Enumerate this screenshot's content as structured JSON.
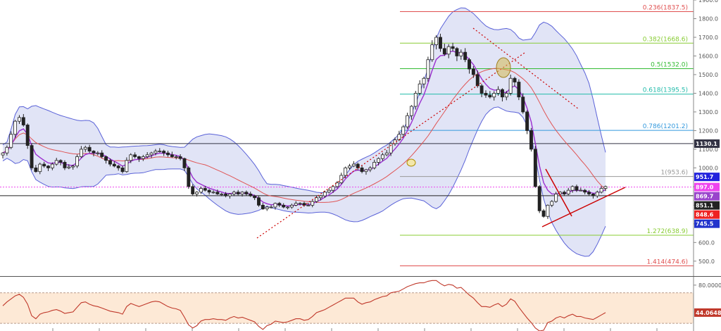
{
  "chart_data": [
    {
      "type": "candlestick",
      "panel": "price",
      "ylim": [
        420,
        1900
      ],
      "y_axis_side": "right",
      "y_ticks": [
        "500.0",
        "600.0",
        "700.0",
        "800.0",
        "900.0",
        "1000.0",
        "1100.0",
        "1200.0",
        "1300.0",
        "1400.0",
        "1500.0",
        "1600.0",
        "1700.0",
        "1800.0",
        "1900.0"
      ],
      "y_tick_values": [
        500,
        600,
        700,
        800,
        900,
        1000,
        1100,
        1200,
        1300,
        1400,
        1500,
        1600,
        1700,
        1800,
        1900
      ],
      "grid": false,
      "indicators": [
        "Bollinger Bands",
        "EMA (purple)",
        "SMA (red)"
      ],
      "fib_levels": [
        {
          "label": "0.236(1837.5)",
          "value": 1837.5,
          "color": "#e05050"
        },
        {
          "label": "0.382(1668.6)",
          "value": 1668.6,
          "color": "#88cc33"
        },
        {
          "label": "0.5(1532.0)",
          "value": 1532.0,
          "color": "#33bb33"
        },
        {
          "label": "0.618(1395.5)",
          "value": 1395.5,
          "color": "#22bbaa"
        },
        {
          "label": "0.786(1201.2)",
          "value": 1201.2,
          "color": "#3399dd"
        },
        {
          "label": "1(953.6)",
          "value": 953.6,
          "color": "#999999"
        },
        {
          "label": "1.272(638.9)",
          "value": 638.9,
          "color": "#88cc33"
        },
        {
          "label": "1.414(474.6)",
          "value": 474.6,
          "color": "#e05050"
        }
      ],
      "price_tags": [
        {
          "label": "1130.1",
          "value": 1130.1,
          "bg": "#333344"
        },
        {
          "label": "951.7",
          "value": 951.7,
          "bg": "#2222dd"
        },
        {
          "label": "897.0",
          "value": 897.0,
          "bg": "#ee44ee"
        },
        {
          "label": "869.7",
          "value": 869.7,
          "bg": "#9944cc"
        },
        {
          "label": "851.1",
          "value": 851.1,
          "bg": "#222222"
        },
        {
          "label": "848.6",
          "value": 848.6,
          "bg": "#ee2222"
        },
        {
          "label": "745.5",
          "value": 745.5,
          "bg": "#2233cc"
        }
      ],
      "horizontal_lines": [
        {
          "value": 1130.1,
          "color": "#333344",
          "style": "solid"
        },
        {
          "value": 851.1,
          "color": "#222222",
          "style": "solid"
        },
        {
          "value": 897.0,
          "color": "#ee44ee",
          "style": "dotted"
        }
      ],
      "close": [
        1080,
        1110,
        1180,
        1250,
        1270,
        1230,
        1120,
        1000,
        980,
        1020,
        1010,
        1000,
        1020,
        1040,
        1030,
        1000,
        1005,
        1010,
        1060,
        1100,
        1110,
        1090,
        1080,
        1080,
        1060,
        1040,
        1020,
        1010,
        1000,
        980,
        1040,
        1070,
        1060,
        1050,
        1060,
        1070,
        1080,
        1090,
        1090,
        1080,
        1070,
        1060,
        1060,
        1050,
        1000,
        900,
        860,
        870,
        890,
        880,
        870,
        870,
        860,
        860,
        850,
        860,
        870,
        860,
        870,
        860,
        850,
        840,
        800,
        780,
        790,
        790,
        810,
        800,
        790,
        790,
        800,
        810,
        810,
        800,
        800,
        820,
        840,
        850,
        870,
        880,
        900,
        920,
        960,
        1000,
        1010,
        1020,
        1000,
        980,
        990,
        1000,
        1030,
        1050,
        1070,
        1080,
        1130,
        1150,
        1180,
        1220,
        1280,
        1330,
        1400,
        1450,
        1480,
        1580,
        1660,
        1700,
        1640,
        1610,
        1650,
        1640,
        1600,
        1620,
        1580,
        1530,
        1500,
        1440,
        1400,
        1390,
        1380,
        1400,
        1420,
        1380,
        1400,
        1480,
        1460,
        1380,
        1300,
        1200,
        1100,
        900,
        770,
        740,
        800,
        820,
        860,
        870,
        860,
        880,
        900,
        880,
        880,
        870,
        860,
        850,
        870,
        890,
        900
      ]
    },
    {
      "type": "line",
      "panel": "oscillator",
      "ylim": [
        20,
        90
      ],
      "y_ticks": [
        "80.0000"
      ],
      "y_tick_values": [
        80
      ],
      "bands": [
        70,
        30
      ],
      "current_label": "44.0648",
      "current_value": 44.0648,
      "values": [
        53,
        58,
        62,
        66,
        68,
        64,
        55,
        40,
        36,
        42,
        44,
        45,
        47,
        48,
        46,
        43,
        44,
        45,
        51,
        57,
        58,
        55,
        53,
        52,
        50,
        48,
        46,
        45,
        44,
        42,
        52,
        56,
        54,
        52,
        54,
        56,
        58,
        59,
        58,
        55,
        52,
        50,
        49,
        47,
        38,
        28,
        24,
        27,
        33,
        35,
        35,
        36,
        35,
        35,
        34,
        37,
        39,
        37,
        38,
        36,
        34,
        32,
        26,
        22,
        27,
        29,
        33,
        32,
        31,
        32,
        34,
        36,
        36,
        34,
        35,
        39,
        44,
        46,
        48,
        51,
        54,
        57,
        60,
        63,
        63,
        63,
        58,
        55,
        57,
        58,
        61,
        63,
        65,
        66,
        70,
        71,
        72,
        75,
        78,
        80,
        82,
        83,
        83,
        85,
        86,
        86,
        82,
        79,
        81,
        80,
        76,
        77,
        72,
        67,
        63,
        57,
        52,
        52,
        51,
        54,
        56,
        52,
        55,
        62,
        59,
        51,
        44,
        37,
        31,
        24,
        20,
        21,
        31,
        33,
        37,
        39,
        37,
        40,
        42,
        39,
        39,
        37,
        36,
        35,
        38,
        41,
        44
      ]
    }
  ]
}
